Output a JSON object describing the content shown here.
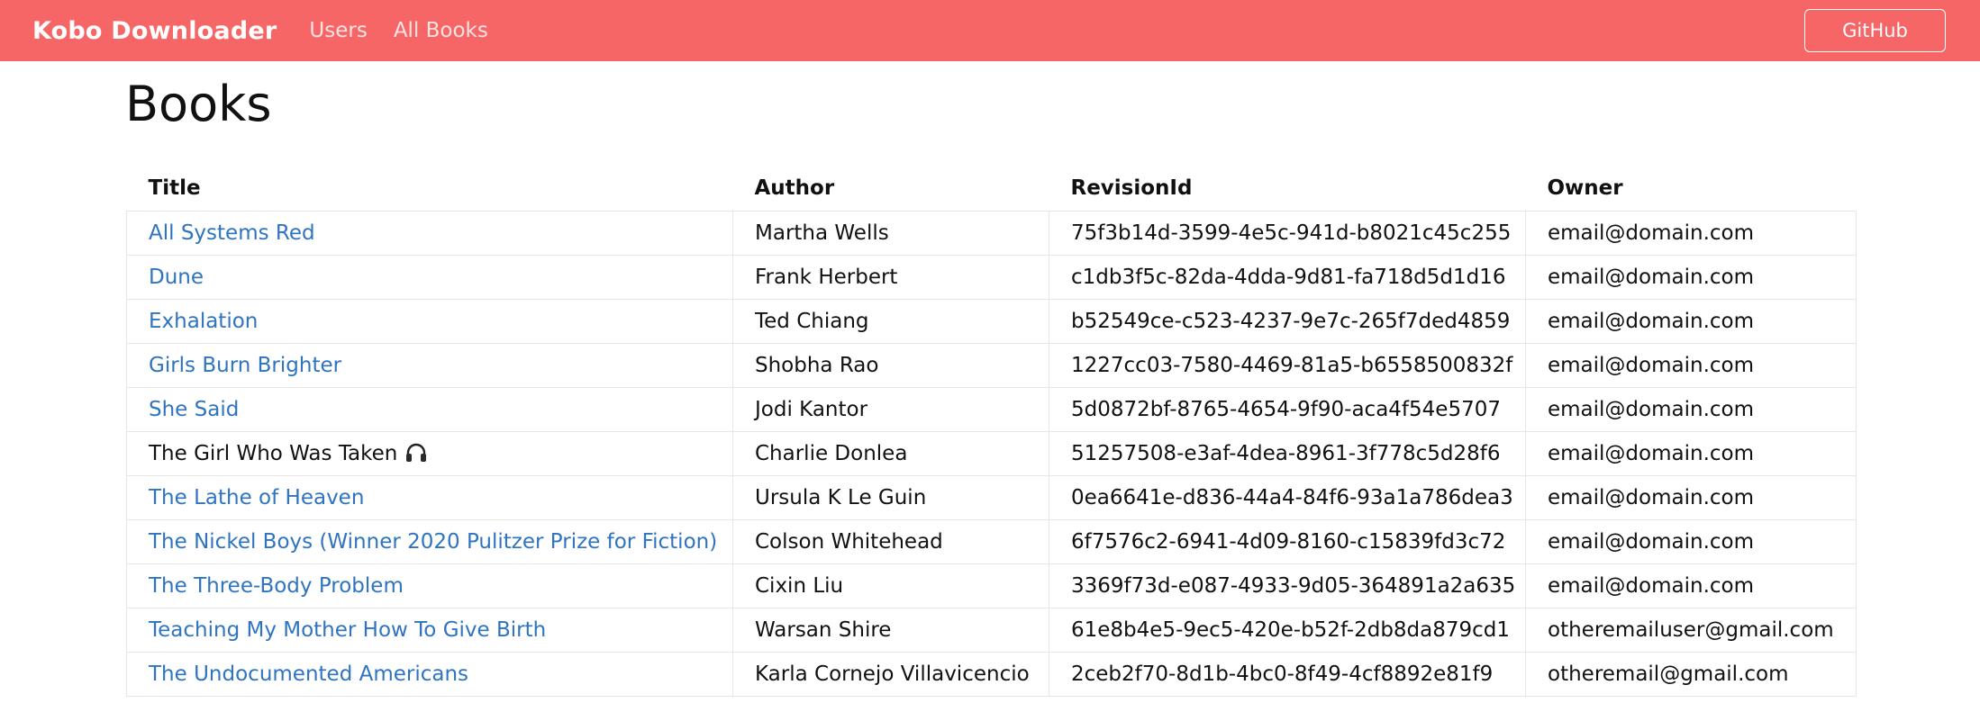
{
  "navbar": {
    "brand": "Kobo Downloader",
    "links": [
      "Users",
      "All Books"
    ],
    "github_label": "GitHub"
  },
  "page": {
    "title": "Books"
  },
  "table": {
    "headers": [
      "Title",
      "Author",
      "RevisionId",
      "Owner"
    ],
    "rows": [
      {
        "title": "All Systems Red",
        "author": "Martha Wells",
        "revision": "75f3b14d-3599-4e5c-941d-b8021c45c255",
        "owner": "email@domain.com",
        "linked": true
      },
      {
        "title": "Dune",
        "author": "Frank Herbert",
        "revision": "c1db3f5c-82da-4dda-9d81-fa718d5d1d16",
        "owner": "email@domain.com",
        "linked": true
      },
      {
        "title": "Exhalation",
        "author": "Ted Chiang",
        "revision": "b52549ce-c523-4237-9e7c-265f7ded4859",
        "owner": "email@domain.com",
        "linked": true
      },
      {
        "title": "Girls Burn Brighter",
        "author": "Shobha Rao",
        "revision": "1227cc03-7580-4469-81a5-b6558500832f",
        "owner": "email@domain.com",
        "linked": true
      },
      {
        "title": "She Said",
        "author": "Jodi Kantor",
        "revision": "5d0872bf-8765-4654-9f90-aca4f54e5707",
        "owner": "email@domain.com",
        "linked": true
      },
      {
        "title": "The Girl Who Was Taken",
        "author": "Charlie Donlea",
        "revision": "51257508-e3af-4dea-8961-3f778c5d28f6",
        "owner": "email@domain.com",
        "linked": false,
        "icon": "headphones-icon"
      },
      {
        "title": "The Lathe of Heaven",
        "author": "Ursula K Le Guin",
        "revision": "0ea6641e-d836-44a4-84f6-93a1a786dea3",
        "owner": "email@domain.com",
        "linked": true
      },
      {
        "title": "The Nickel Boys (Winner 2020 Pulitzer Prize for Fiction)",
        "author": "Colson Whitehead",
        "revision": "6f7576c2-6941-4d09-8160-c15839fd3c72",
        "owner": "email@domain.com",
        "linked": true
      },
      {
        "title": "The Three-Body Problem",
        "author": "Cixin Liu",
        "revision": "3369f73d-e087-4933-9d05-364891a2a635",
        "owner": "email@domain.com",
        "linked": true
      },
      {
        "title": "Teaching My Mother How To Give Birth",
        "author": "Warsan Shire",
        "revision": "61e8b4e5-9ec5-420e-b52f-2db8da879cd1",
        "owner": "otheremailuser@gmail.com",
        "linked": true
      },
      {
        "title": "The Undocumented Americans",
        "author": "Karla Cornejo Villavicencio",
        "revision": "2ceb2f70-8d1b-4bc0-8f49-4cf8892e81f9",
        "owner": "otheremail@gmail.com",
        "linked": true
      }
    ]
  },
  "colors": {
    "navbar_bg": "#f76666",
    "link": "#2f74c0"
  }
}
